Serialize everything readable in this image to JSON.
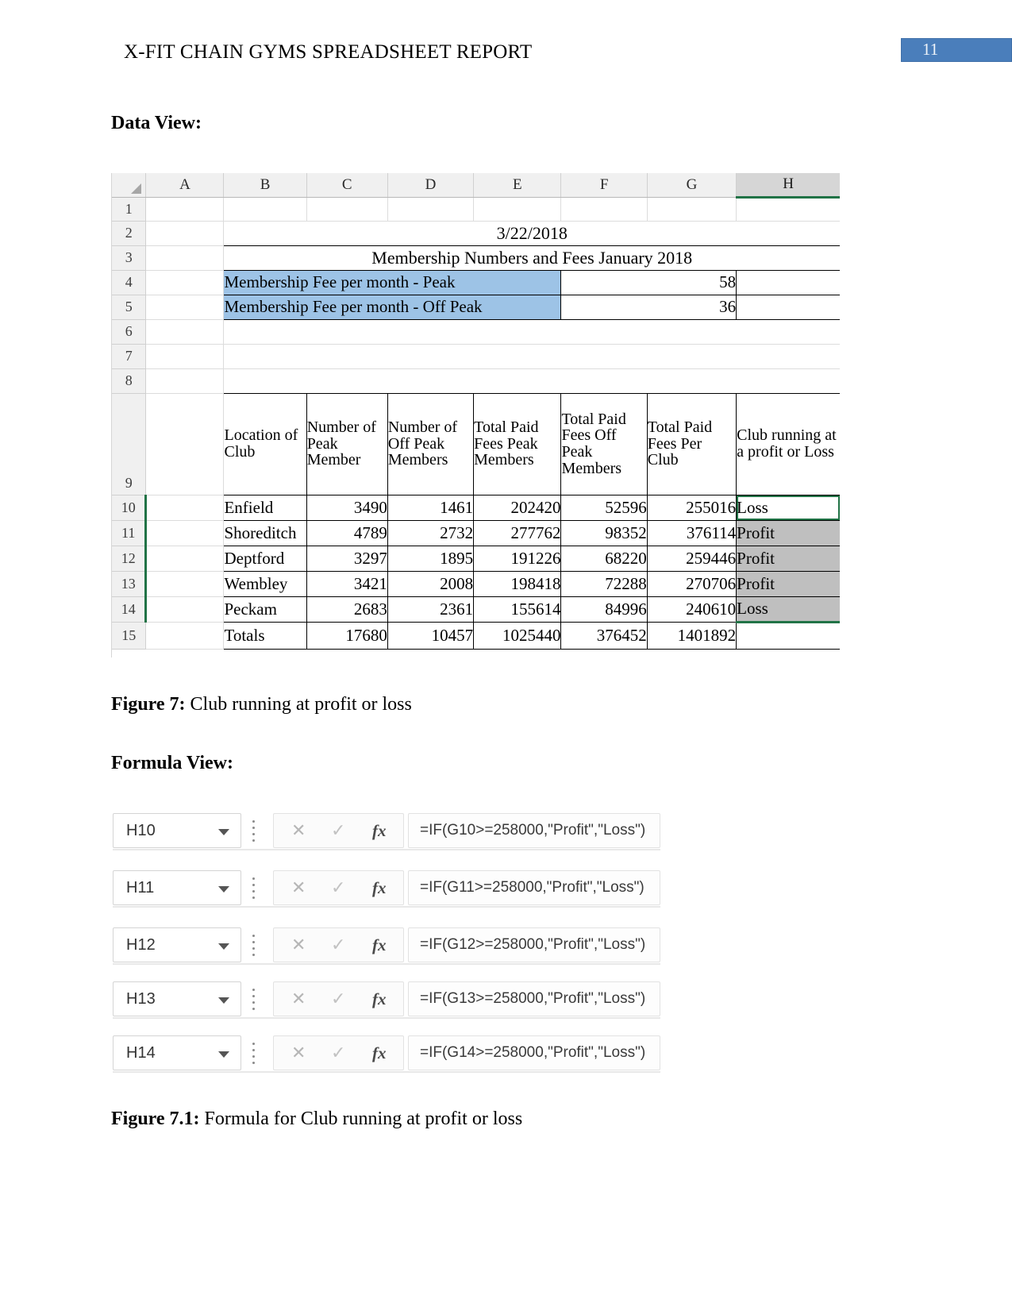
{
  "header": {
    "title": "X-FIT CHAIN GYMS SPREADSHEET REPORT",
    "page_number": "11",
    "badge_color": "#4A7EBB"
  },
  "sections": {
    "data_view_label": "Data View:",
    "formula_view_label": "Formula View:"
  },
  "captions": {
    "figure7_prefix": "Figure 7:",
    "figure7_text": " Club running at profit or loss",
    "figure71_prefix": "Figure 7.1:",
    "figure71_text": " Formula for Club running at profit or loss"
  },
  "spreadsheet": {
    "column_headers": [
      "A",
      "B",
      "C",
      "D",
      "E",
      "F",
      "G",
      "H"
    ],
    "selected_column": "H",
    "row_headers": [
      "1",
      "2",
      "3",
      "4",
      "5",
      "6",
      "7",
      "8",
      "9",
      "10",
      "11",
      "12",
      "13",
      "14",
      "15"
    ],
    "date_cell": "3/22/2018",
    "title_cell": "Membership Numbers and Fees January 2018",
    "fee_rows": [
      {
        "label": "Membership Fee per month - Peak",
        "value": "58"
      },
      {
        "label": "Membership Fee per month - Off Peak",
        "value": "36"
      }
    ],
    "table_headers": [
      "Location of Club",
      "Number of Peak Member",
      "Number of Off Peak Members",
      "Total Paid Fees Peak Members",
      "Total Paid Fees Off Peak Members",
      "Total Paid Fees Per Club",
      "Club running at a profit or Loss"
    ],
    "rows": [
      {
        "location": "Enfield",
        "peak": "3490",
        "offpeak": "1461",
        "feespeak": "202420",
        "feesoffpeak": "52596",
        "feesclub": "255016",
        "status": "Loss"
      },
      {
        "location": "Shoreditch",
        "peak": "4789",
        "offpeak": "2732",
        "feespeak": "277762",
        "feesoffpeak": "98352",
        "feesclub": "376114",
        "status": "Profit"
      },
      {
        "location": "Deptford",
        "peak": "3297",
        "offpeak": "1895",
        "feespeak": "191226",
        "feesoffpeak": "68220",
        "feesclub": "259446",
        "status": "Profit"
      },
      {
        "location": "Wembley",
        "peak": "3421",
        "offpeak": "2008",
        "feespeak": "198418",
        "feesoffpeak": "72288",
        "feesclub": "270706",
        "status": "Profit"
      },
      {
        "location": "Peckam",
        "peak": "2683",
        "offpeak": "2361",
        "feespeak": "155614",
        "feesoffpeak": "84996",
        "feesclub": "240610",
        "status": "Loss"
      }
    ],
    "totals": {
      "label": "Totals",
      "peak": "17680",
      "offpeak": "10457",
      "feespeak": "1025440",
      "feesoffpeak": "376452",
      "feesclub": "1401892",
      "status": ""
    },
    "fill_colors": {
      "fee_label_fill": "#9DC3E6",
      "status_fill": "#BFBFBF",
      "selection_outline": "#217346"
    }
  },
  "formula_bars": [
    {
      "cell_ref": "H10",
      "formula": "=IF(G10>=258000,\"Profit\",\"Loss\")"
    },
    {
      "cell_ref": "H11",
      "formula": "=IF(G11>=258000,\"Profit\",\"Loss\")"
    },
    {
      "cell_ref": "H12",
      "formula": "=IF(G12>=258000,\"Profit\",\"Loss\")"
    },
    {
      "cell_ref": "H13",
      "formula": "=IF(G13>=258000,\"Profit\",\"Loss\")"
    },
    {
      "cell_ref": "H14",
      "formula": "=IF(G14>=258000,\"Profit\",\"Loss\")"
    }
  ],
  "icons": {
    "cancel": "✕",
    "confirm": "✓",
    "function": "fx"
  }
}
